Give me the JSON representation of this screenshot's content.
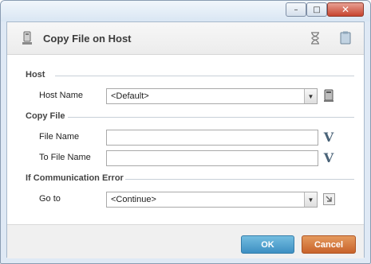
{
  "window": {
    "minimize_glyph": "–",
    "maximize_glyph": "□",
    "close_glyph": "✕"
  },
  "header": {
    "title": "Copy File on Host",
    "icons": [
      "host-icon",
      "hourglass-icon",
      "clipboard-icon"
    ]
  },
  "sections": {
    "host": {
      "title": "Host",
      "host_name_label": "Host Name",
      "host_name_value": "<Default>"
    },
    "copy_file": {
      "title": "Copy File",
      "file_name_label": "File Name",
      "file_name_value": "",
      "to_file_name_label": "To File Name",
      "to_file_name_value": "",
      "variable_glyph": "V"
    },
    "comm_error": {
      "title": "If Communication Error",
      "goto_label": "Go to",
      "goto_value": "<Continue>"
    }
  },
  "buttons": {
    "ok": "OK",
    "cancel": "Cancel"
  },
  "colors": {
    "ok_button": "#4a9fd0",
    "cancel_button": "#d6743a",
    "close_button": "#c7442f"
  }
}
